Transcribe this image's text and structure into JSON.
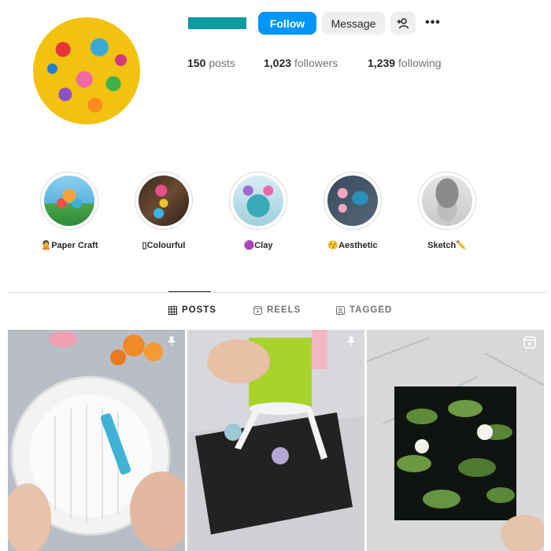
{
  "header": {
    "follow_label": "Follow",
    "message_label": "Message",
    "add_user_icon": "add-user-icon",
    "more_icon": "more-icon",
    "more_glyph": "•••"
  },
  "stats": {
    "posts_count": "150",
    "posts_label": "posts",
    "followers_count": "1,023",
    "followers_label": "followers",
    "following_count": "1,239",
    "following_label": "following"
  },
  "highlights": [
    {
      "label": "🙎Paper Craft"
    },
    {
      "label": "▯Colourful"
    },
    {
      "label": "🟣Clay"
    },
    {
      "label": "😚Aesthetic"
    },
    {
      "label": "Sketch✏️"
    }
  ],
  "tabs": [
    {
      "label": "POSTS",
      "icon": "grid-icon",
      "active": true
    },
    {
      "label": "REELS",
      "icon": "reels-icon",
      "active": false
    },
    {
      "label": "TAGGED",
      "icon": "tagged-icon",
      "active": false
    }
  ],
  "posts": [
    {
      "badge": "pin-icon"
    },
    {
      "badge": "pin-icon"
    },
    {
      "badge": "reels-icon"
    }
  ],
  "colors": {
    "follow_button": "#0095f6",
    "name_bar": "#0b9ba3"
  }
}
